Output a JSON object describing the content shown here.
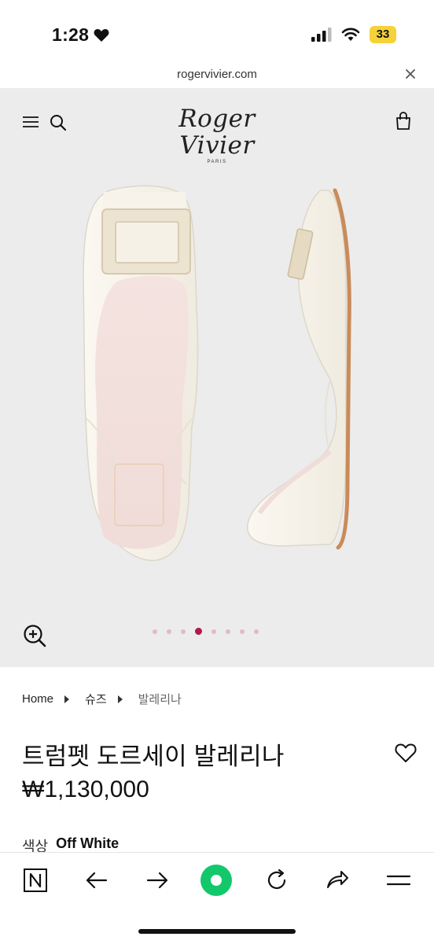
{
  "status": {
    "time": "1:28",
    "battery": "33"
  },
  "browser": {
    "url": "rogervivier.com"
  },
  "header": {
    "brand": "Roger Vivier",
    "brand_sub": "PARIS"
  },
  "gallery": {
    "slide_count": 8,
    "active_slide": 4
  },
  "breadcrumb": [
    {
      "label": "Home"
    },
    {
      "label": "슈즈"
    },
    {
      "label": "발레리나"
    }
  ],
  "product": {
    "title": "트럼펫 도르세이 발레리나",
    "price": "₩1,130,000",
    "color_label": "색상",
    "color_value": "Off White"
  },
  "colors": {
    "hero_bg": "#ececec",
    "dot_active": "#b3174b",
    "dot_inactive": "#e4b9c5",
    "nav_green": "#12c86b"
  },
  "icons": [
    "heart-icon",
    "signal-icon",
    "wifi-icon",
    "close-icon",
    "menu-icon",
    "search-icon",
    "bag-icon",
    "zoom-in-icon",
    "wishlist-heart-icon",
    "n-home-icon",
    "back-arrow-icon",
    "forward-arrow-icon",
    "green-dot-icon",
    "reload-icon",
    "share-icon",
    "hamburger-icon"
  ]
}
